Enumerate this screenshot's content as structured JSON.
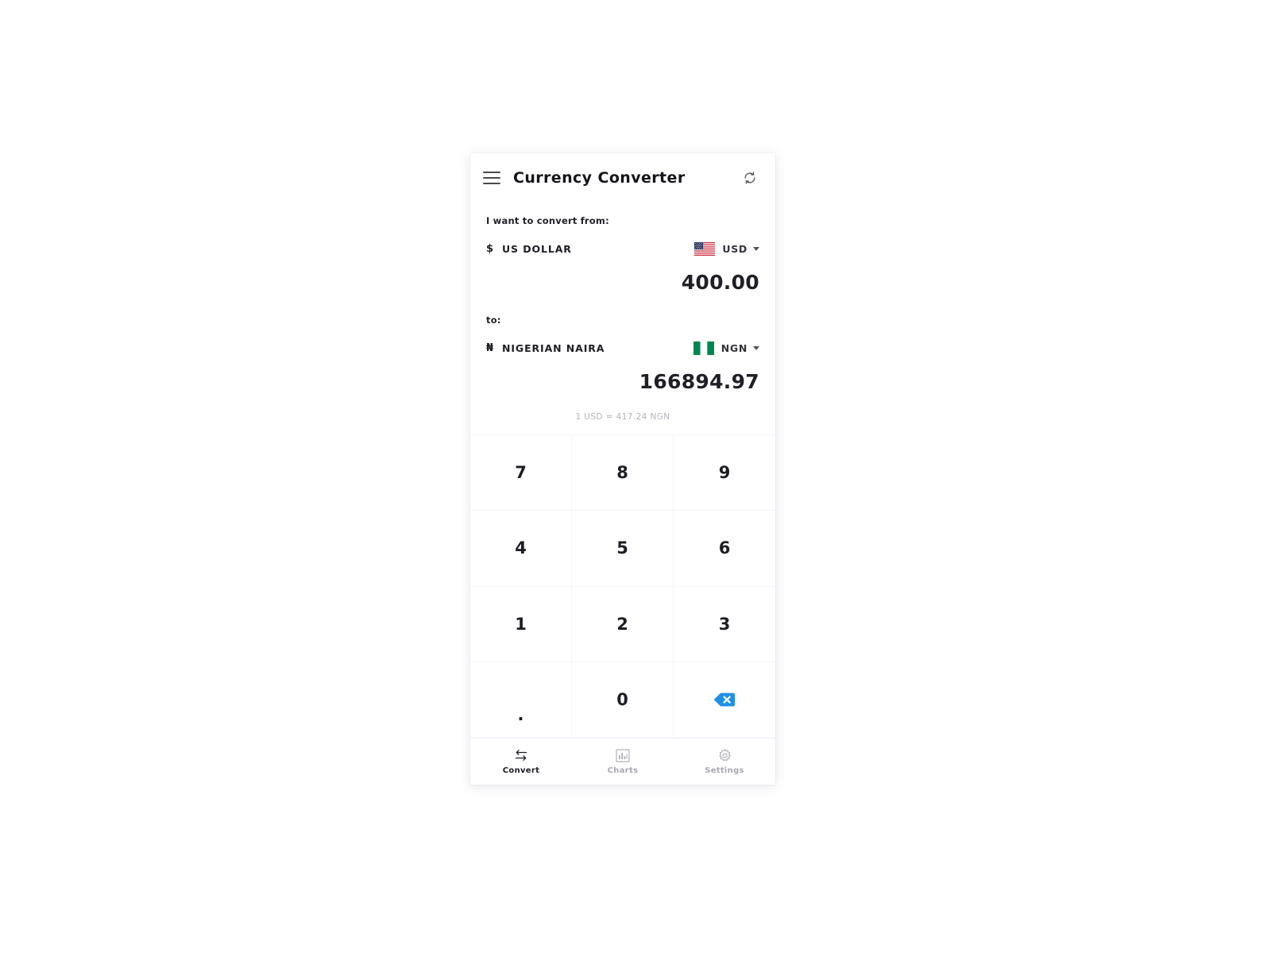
{
  "app": {
    "title": "Currency Converter",
    "menu_icon": "hamburger-menu-icon",
    "refresh_icon": "refresh-icon"
  },
  "colors": {
    "accent_blue": "#1E90E8",
    "text_dark": "#1d1d24",
    "text_muted": "#b3b3bb",
    "nigeria_green": "#008751",
    "grid_line": "#f2f5fc"
  },
  "convert_from": {
    "label": "I want to convert from:",
    "currency_symbol": "$",
    "currency_name": "US DOLLAR",
    "currency_code": "USD",
    "flag": "us-flag",
    "amount": "400.00"
  },
  "convert_to": {
    "label": "to:",
    "currency_symbol": "₦",
    "currency_name": "NIGERIAN NAIRA",
    "currency_code": "NGN",
    "flag": "ng-flag",
    "amount": "166894.97"
  },
  "rate": {
    "text": "1 USD = 417.24 NGN",
    "base": "1 USD",
    "value": "417.24",
    "quote": "NGN"
  },
  "keypad": {
    "keys": [
      {
        "label": "7",
        "name": "key-7"
      },
      {
        "label": "8",
        "name": "key-8"
      },
      {
        "label": "9",
        "name": "key-9"
      },
      {
        "label": "4",
        "name": "key-4"
      },
      {
        "label": "5",
        "name": "key-5"
      },
      {
        "label": "6",
        "name": "key-6"
      },
      {
        "label": "1",
        "name": "key-1"
      },
      {
        "label": "2",
        "name": "key-2"
      },
      {
        "label": "3",
        "name": "key-3"
      },
      {
        "label": ".",
        "name": "key-decimal"
      },
      {
        "label": "0",
        "name": "key-0"
      },
      {
        "label": "",
        "name": "key-backspace"
      }
    ]
  },
  "bottom_nav": {
    "items": [
      {
        "label": "Convert",
        "icon": "swap-arrows-icon",
        "active": true
      },
      {
        "label": "Charts",
        "icon": "bar-chart-icon",
        "active": false
      },
      {
        "label": "Settings",
        "icon": "gear-icon",
        "active": false
      }
    ]
  }
}
